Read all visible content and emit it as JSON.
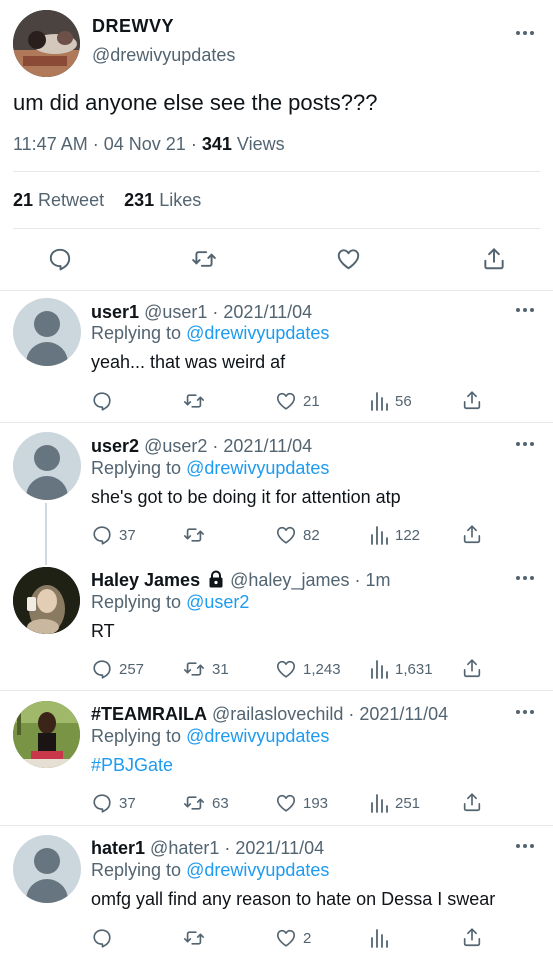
{
  "main_tweet": {
    "display_name": "DREWVY",
    "handle": "@drewivyupdates",
    "text": "um did anyone else see the posts???",
    "time": "11:47 AM",
    "date": "04 Nov 21",
    "views_count": "341",
    "views_label": "Views",
    "retweets_count": "21",
    "retweets_label": "Retweet",
    "likes_count": "231",
    "likes_label": "Likes"
  },
  "replies": [
    {
      "name": "user1",
      "handle": "@user1",
      "date": "2021/11/04",
      "replying_prefix": "Replying to",
      "replying_to": "@drewivyupdates",
      "text": "yeah... that was weird af",
      "replies": "",
      "retweets": "",
      "likes": "21",
      "views": "56"
    },
    {
      "name": "user2",
      "handle": "@user2",
      "date": "2021/11/04",
      "replying_prefix": "Replying to",
      "replying_to": "@drewivyupdates",
      "text": "she's got to be doing it for attention atp",
      "replies": "37",
      "retweets": "",
      "likes": "82",
      "views": "122"
    },
    {
      "name": "Haley James",
      "handle": "@haley_james",
      "date": "1m",
      "replying_prefix": "Replying to",
      "replying_to": "@user2",
      "text": "RT",
      "replies": "257",
      "retweets": "31",
      "likes": "1,243",
      "views": "1,631"
    },
    {
      "name": "#TEAMRAILA",
      "handle": "@railaslovechild",
      "date": "2021/11/04",
      "replying_prefix": "Replying to",
      "replying_to": "@drewivyupdates",
      "text": "#PBJGate",
      "replies": "37",
      "retweets": "63",
      "likes": "193",
      "views": "251"
    },
    {
      "name": "hater1",
      "handle": "@hater1",
      "date": "2021/11/04",
      "replying_prefix": "Replying to",
      "replying_to": "@drewivyupdates",
      "text": "omfg yall find any reason to hate on Dessa I swear",
      "replies": "",
      "retweets": "",
      "likes": "2",
      "views": ""
    }
  ],
  "separator": "·",
  "colors": {
    "link_blue": "#1d9bf0",
    "secondary_text": "#536471",
    "divider": "#e6e9eb"
  },
  "icons": [
    "reply-icon",
    "retweet-icon",
    "like-icon",
    "share-icon",
    "views-icon",
    "more-icon",
    "lock-icon",
    "default-avatar-icon"
  ]
}
